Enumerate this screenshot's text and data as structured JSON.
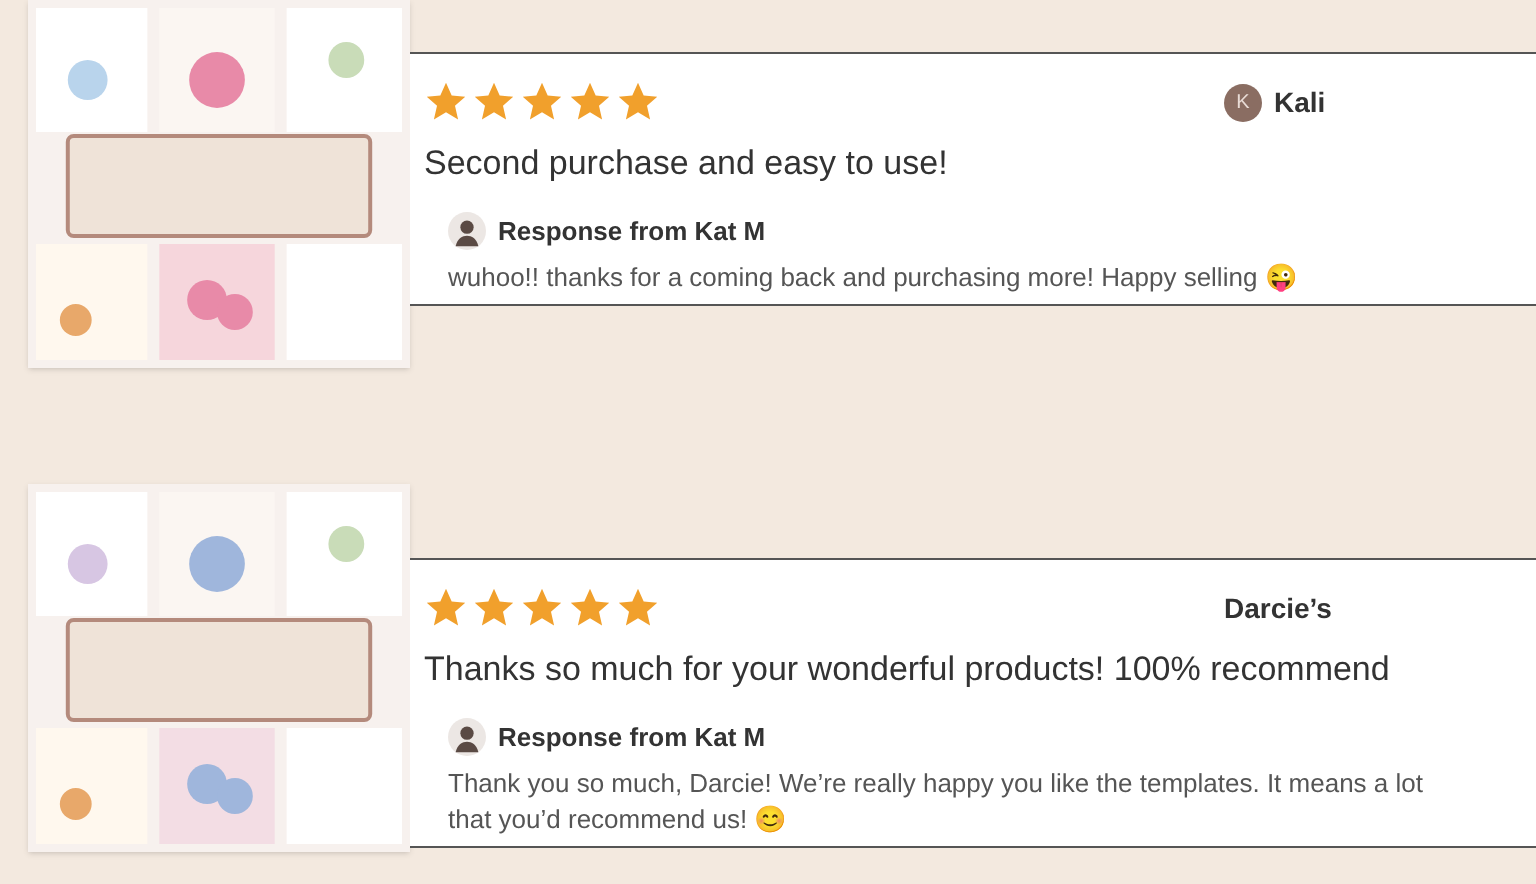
{
  "reviews": [
    {
      "stars": 5,
      "reviewer": {
        "name": "Kali",
        "initial": "K"
      },
      "text": "Second purchase and easy to use!",
      "response": {
        "title": "Response from Kat M",
        "message": "wuhoo!! thanks for a coming back and purchasing more! Happy selling 😜"
      }
    },
    {
      "stars": 5,
      "reviewer": {
        "name": "Darcie’s"
      },
      "text": "Thanks so much for your wonderful products! 100% recommend",
      "response": {
        "title": "Response from Kat M",
        "message": "Thank you so much, Darcie! We’re really happy you like the templates. It means a lot that you’d recommend us! 😊"
      }
    }
  ]
}
